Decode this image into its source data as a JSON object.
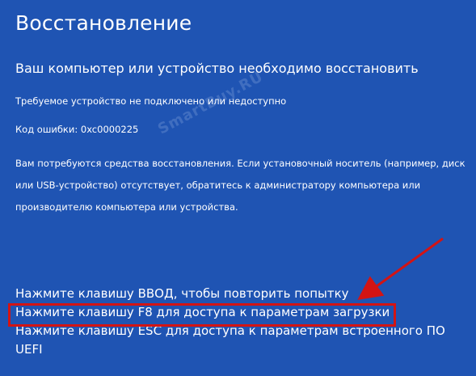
{
  "screen": {
    "title": "Восстановление",
    "subtitle": "Ваш компьютер или устройство необходимо восстановить",
    "status": "Требуемое устройство не подключено или недоступно",
    "error_code": "Код ошибки: 0xc0000225",
    "info": "Вам потребуются средства восстановления. Если установочный носитель (например, диск или USB-устройство) отсутствует, обратитесь к администратору компьютера или производителю компьютера или устройства."
  },
  "actions": {
    "retry": "Нажмите клавишу ВВОД, чтобы повторить попытку",
    "boot_options": "Нажмите клавишу F8 для доступа к параметрам загрузки",
    "uefi": "Нажмите клавишу ESC для доступа к параметрам встроенного ПО UEFI"
  },
  "watermark": {
    "text": "SmartBuy.RU"
  },
  "colors": {
    "background": "#1f54b3",
    "text": "#ffffff",
    "annotation": "#d31414"
  }
}
